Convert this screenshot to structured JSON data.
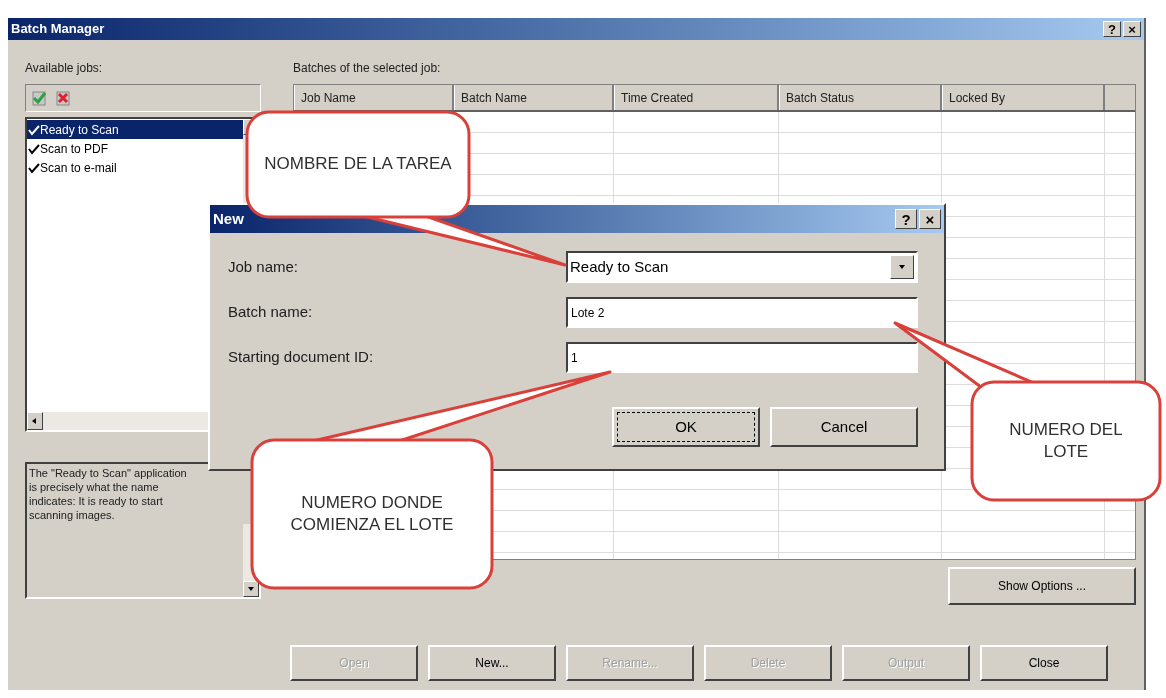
{
  "window": {
    "title": "Batch Manager",
    "title_buttons": [
      "?",
      "×"
    ]
  },
  "jobs_panel": {
    "label": "Available jobs:",
    "items": [
      {
        "label": "Ready to Scan",
        "checked": true,
        "selected": true
      },
      {
        "label": "Scan to PDF",
        "checked": true,
        "selected": false
      },
      {
        "label": "Scan to e-mail",
        "checked": true,
        "selected": false
      }
    ],
    "description": "The \"Ready to Scan\" application is precisely what the name indicates: It is ready to start scanning images."
  },
  "batches": {
    "label": "Batches of the selected job:",
    "columns": [
      "Job Name",
      "Batch Name",
      "Time Created",
      "Batch Status",
      "Locked By"
    ]
  },
  "show_options_button": "Show Options ...",
  "buttons": [
    {
      "label": "Open",
      "disabled": true
    },
    {
      "label": "New...",
      "disabled": false
    },
    {
      "label": "Rename...",
      "disabled": true
    },
    {
      "label": "Delete",
      "disabled": true
    },
    {
      "label": "Output",
      "disabled": true
    },
    {
      "label": "Close",
      "disabled": false
    }
  ],
  "dialog": {
    "title": "New",
    "title_buttons": [
      "?",
      "×"
    ],
    "fields": [
      {
        "kind": "dropdown",
        "label": "Job name:",
        "value": "Ready to Scan"
      },
      {
        "kind": "text",
        "label": "Batch name:",
        "value": "Lote 2"
      },
      {
        "kind": "text",
        "label": "Starting document ID:",
        "value": "1"
      }
    ],
    "buttons": [
      {
        "label": "OK",
        "focused": true
      },
      {
        "label": "Cancel",
        "focused": false
      }
    ]
  },
  "callouts": [
    {
      "text": "NOMBRE DE LA TAREA"
    },
    {
      "text": "NUMERO DEL LOTE"
    },
    {
      "text": "NUMERO DONDE COMIENZA EL LOTE"
    }
  ]
}
